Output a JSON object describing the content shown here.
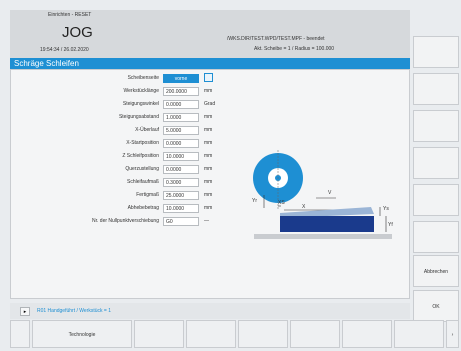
{
  "header": {
    "mode": "Einrichten - RESET",
    "title": "JOG",
    "datetime": "19:54:34 / 26.02.2020",
    "program": "/WKS.DIR/TEST.WPD/TEST.MPF - beendet",
    "status": "Akt. Scheibe = 1  /  Radius = 100.000"
  },
  "window_title": "Schräge Schleifen",
  "fields": [
    {
      "label": "Scheibenseite",
      "value": "vorne",
      "unit": ""
    },
    {
      "label": "Werkstücklänge",
      "value": "200.0000",
      "unit": "mm"
    },
    {
      "label": "Steigungswinkel",
      "value": "0.0000",
      "unit": "Grad"
    },
    {
      "label": "Steigungsabstand",
      "value": "1.0000",
      "unit": "mm"
    },
    {
      "label": "X-Überlauf",
      "value": "5.0000",
      "unit": "mm"
    },
    {
      "label": "X-Startposition",
      "value": "0.0000",
      "unit": "mm"
    },
    {
      "label": "Z Schleifposition",
      "value": "10.0000",
      "unit": "mm"
    },
    {
      "label": "Querzustellung",
      "value": "0.0000",
      "unit": "mm"
    },
    {
      "label": "Schleifaufmaß",
      "value": "0.3000",
      "unit": "mm"
    },
    {
      "label": "Fertigmaß",
      "value": "25.0000",
      "unit": "mm"
    },
    {
      "label": "Abhebebetrag",
      "value": "10.0000",
      "unit": "mm"
    },
    {
      "label": "Nr. der Nullpunktverschiebung",
      "value": "G0",
      "unit": "—"
    }
  ],
  "diagram": {
    "labels": {
      "yr": "Yr",
      "xs": "XS",
      "x": "X",
      "v": "V",
      "ys": "Ys",
      "yf": "Yf"
    },
    "colors": {
      "wheel": "#1e8fd3",
      "workpiece": "#1a3a8c"
    }
  },
  "softkeys": {
    "right": [
      "",
      "",
      "",
      "",
      "",
      "",
      "Abbrechen",
      "OK"
    ],
    "bottom": [
      "",
      "Technologie",
      "",
      "",
      "",
      "",
      "",
      "",
      ""
    ]
  },
  "message": "R01   Handgeführt / Werkstück = 1",
  "colors": {
    "accent": "#1e8fd3"
  }
}
